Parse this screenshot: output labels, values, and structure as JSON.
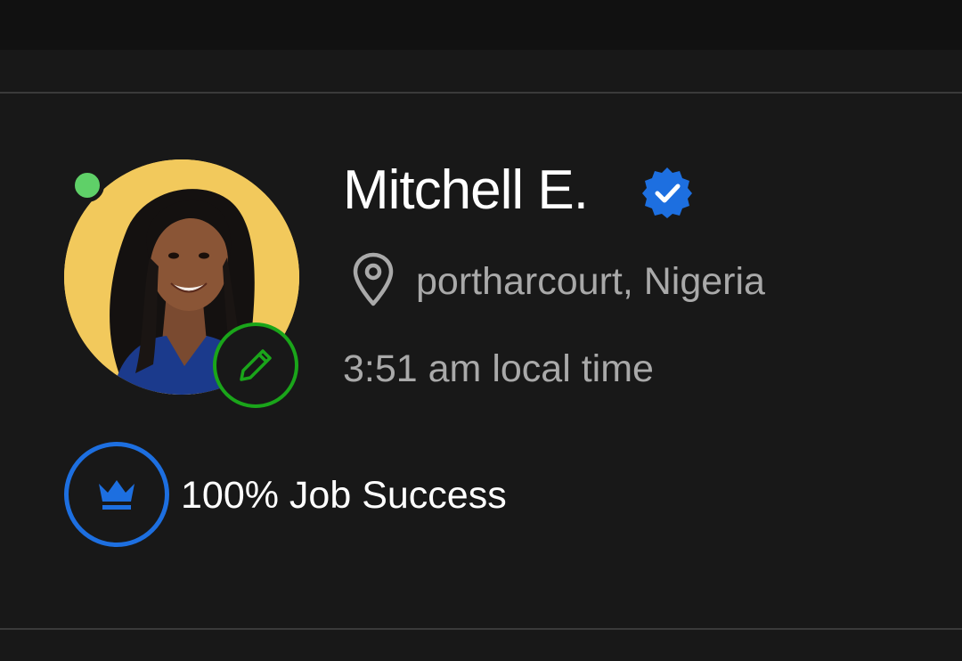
{
  "profile": {
    "name": "Mitchell E.",
    "location": "portharcourt, Nigeria",
    "local_time": "3:51 am local time",
    "job_success": "100% Job Success",
    "status": "online",
    "verified": true
  },
  "icons": {
    "verified": "verified-badge-icon",
    "location": "map-pin-icon",
    "edit": "pencil-icon",
    "job_success": "crown-icon"
  },
  "colors": {
    "background": "#181818",
    "online": "#5fd068",
    "verified": "#1d6fe0",
    "edit_ring": "#1aa51a",
    "avatar_bg": "#f2c95c",
    "secondary_text": "#a9a9a9"
  }
}
